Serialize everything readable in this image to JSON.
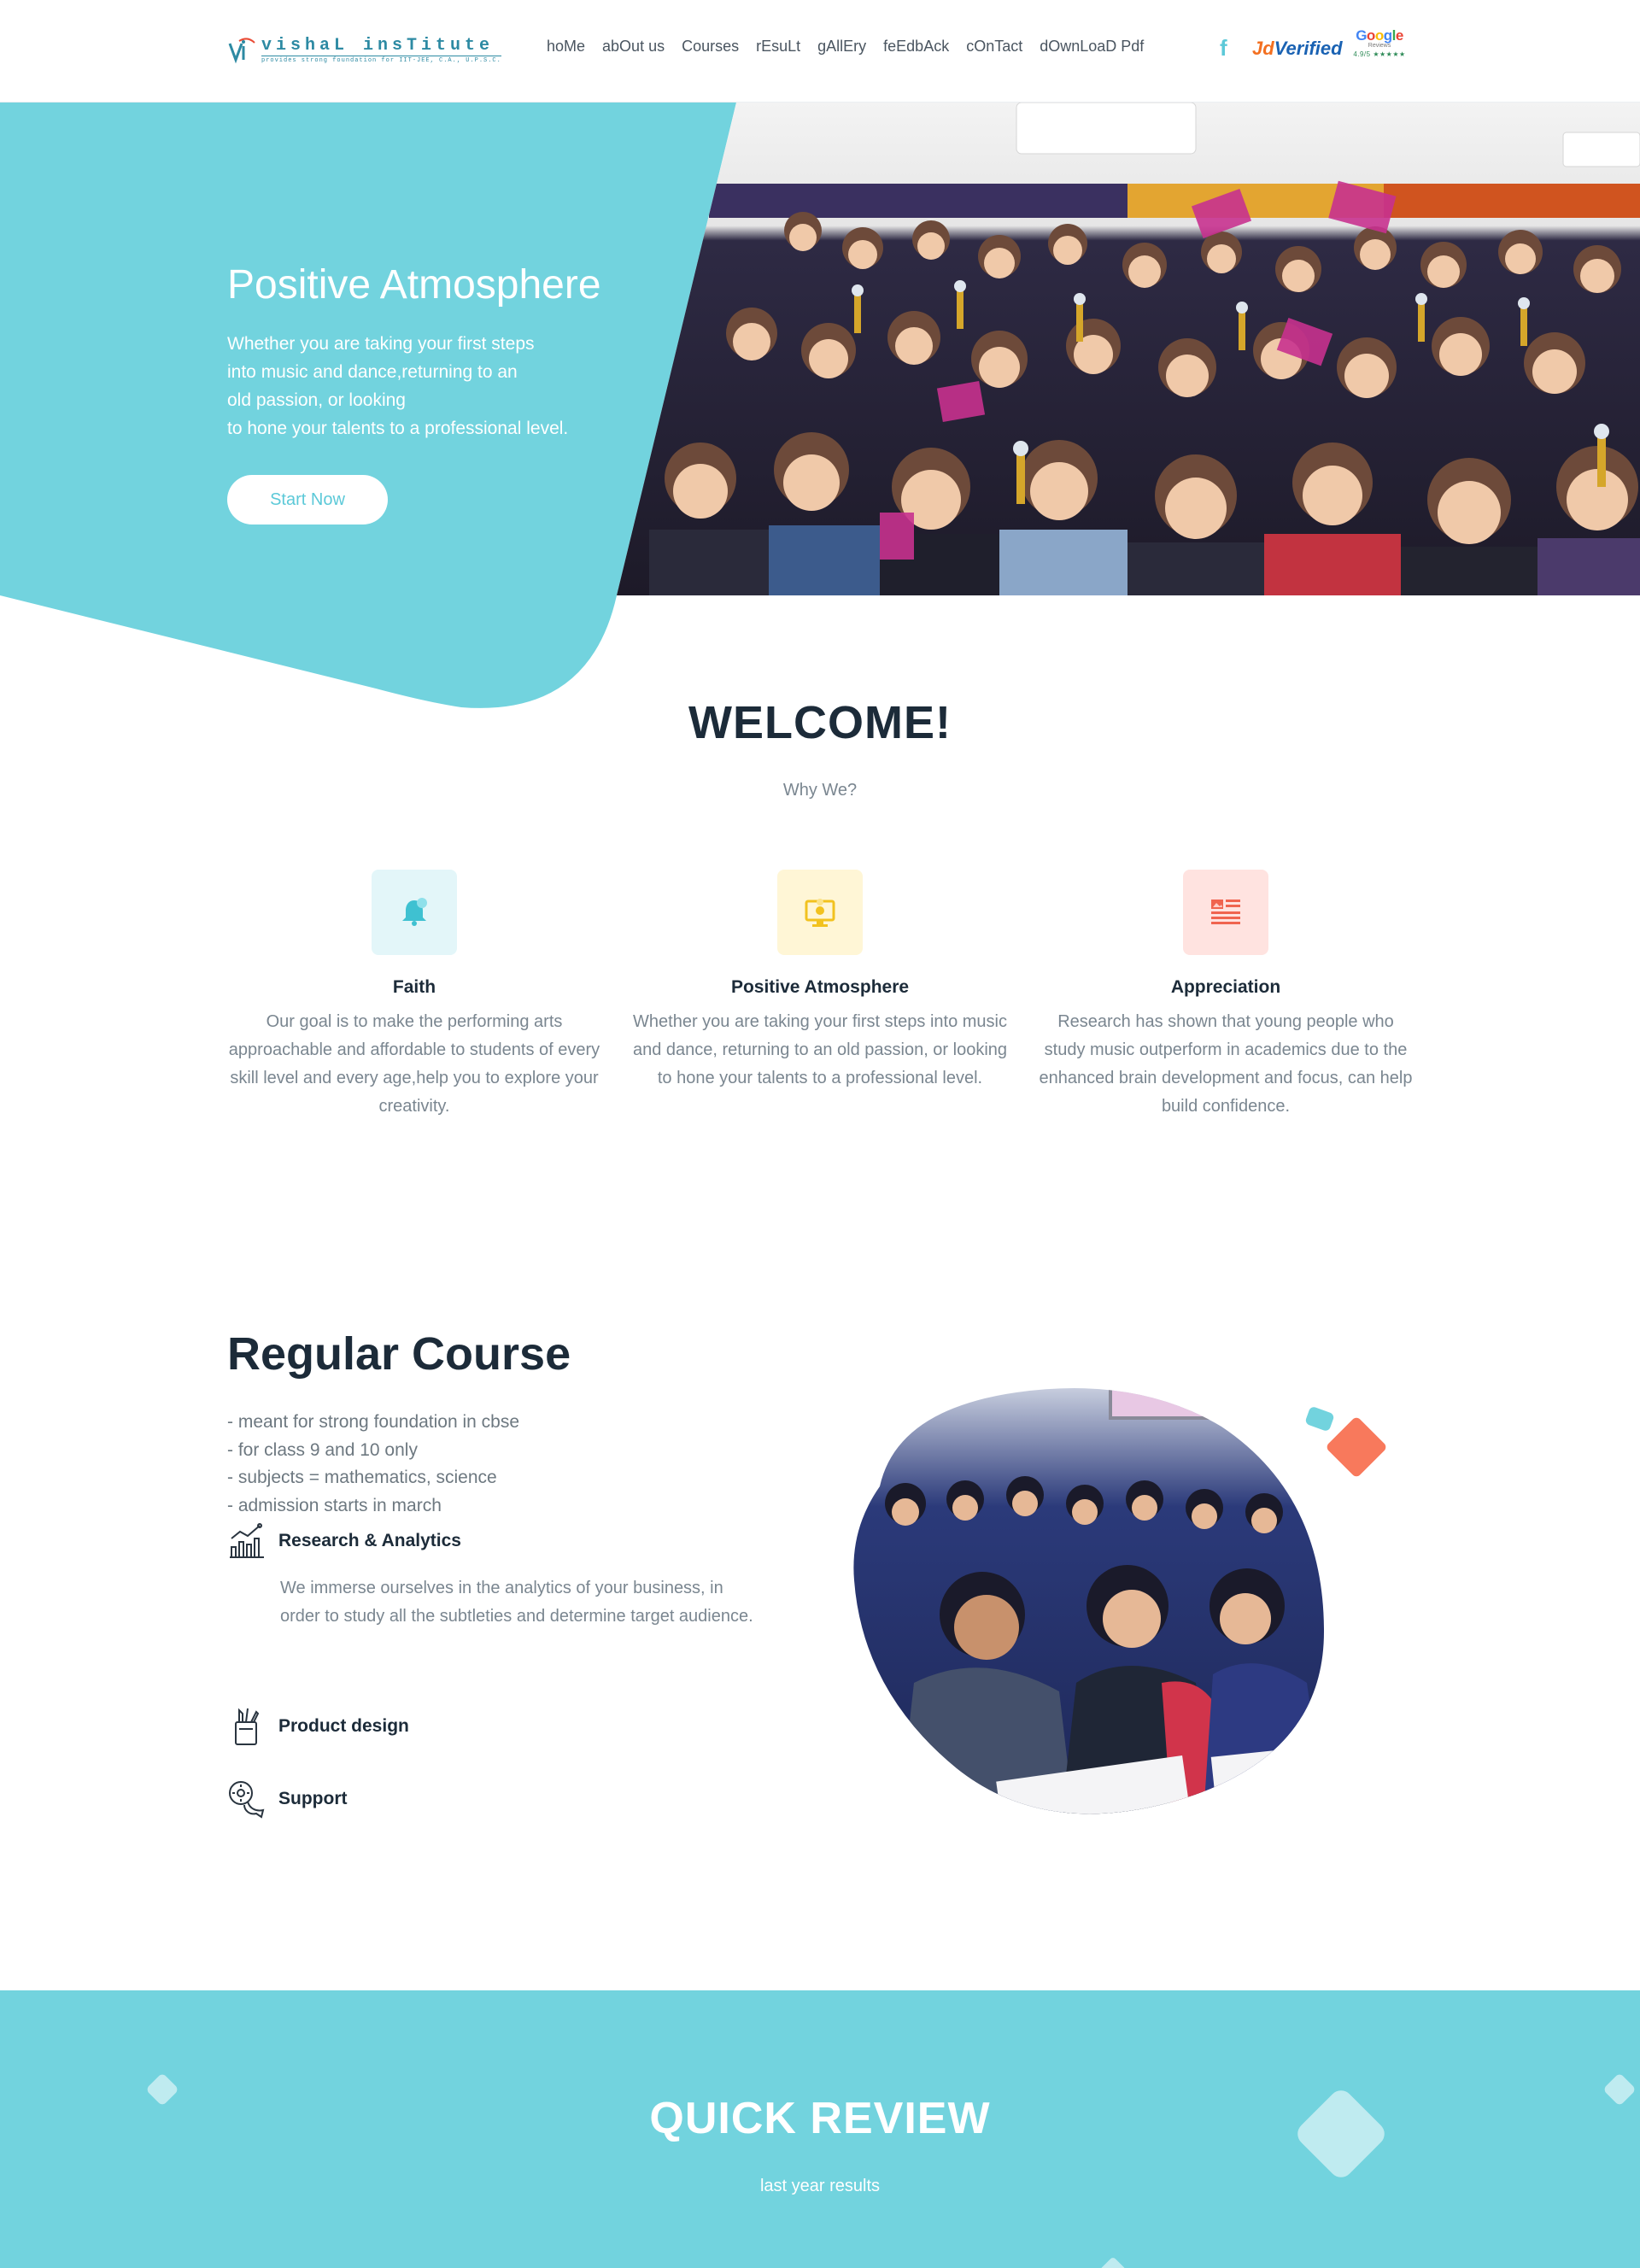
{
  "header": {
    "logo": {
      "title": "vishaL insTitute",
      "tagline": "provides strong foundation for IIT-JEE, C.A., U.P.S.C."
    },
    "nav": [
      {
        "label": "hoMe",
        "name": "nav-home"
      },
      {
        "label": "abOut us",
        "name": "nav-about-us"
      },
      {
        "label": "Courses",
        "name": "nav-courses"
      },
      {
        "label": "rEsuLt",
        "name": "nav-result"
      },
      {
        "label": "gAllEry",
        "name": "nav-gallery"
      },
      {
        "label": "feEdbAck",
        "name": "nav-feedback"
      },
      {
        "label": "cOnTact",
        "name": "nav-contact"
      },
      {
        "label": "dOwnLoaD Pdf",
        "name": "nav-download-pdf"
      }
    ],
    "social": {
      "facebook": "f",
      "jd_prefix": "Jd",
      "jd_suffix": "Verified",
      "google": "Google",
      "google_sub": "Reviews",
      "google_rating": "4.9/5 ★★★★★"
    }
  },
  "hero": {
    "title": "Positive Atmosphere",
    "lines": [
      "Whether you are taking your first steps",
      "into music and dance,returning to an",
      "old passion, or looking",
      "to hone your talents to a professional level."
    ],
    "button": "Start Now",
    "accent_color": "#72d3de"
  },
  "welcome": {
    "title": "WELCOME!",
    "subtitle": "Why We?",
    "features": [
      {
        "icon": "bell-icon",
        "title": "Faith",
        "text": "Our goal is to make the performing arts approachable and affordable to students of every skill level and every age,help you to explore your creativity."
      },
      {
        "icon": "monitor-icon",
        "title": "Positive Atmosphere",
        "text": "Whether you are taking your first steps into music and dance, returning to an old passion, or looking to hone your talents to a professional level."
      },
      {
        "icon": "newspaper-icon",
        "title": "Appreciation",
        "text": "Research has shown that young people who study music outperform in academics due to the enhanced brain development and focus, can help build confidence."
      }
    ]
  },
  "course": {
    "title": "Regular Course",
    "points": [
      "- meant for strong foundation in cbse",
      "- for class 9 and 10 only",
      "- subjects = mathematics, science",
      "- admission starts in march"
    ],
    "services": [
      {
        "icon": "chart-icon",
        "label": "Research & Analytics",
        "desc": "We immerse ourselves in the analytics of your business, in order to study all the subtleties and determine target audience."
      },
      {
        "icon": "pencil-cup-icon",
        "label": "Product design"
      },
      {
        "icon": "chat-gear-icon",
        "label": "Support"
      }
    ]
  },
  "review": {
    "title": "QUICK REVIEW",
    "subtitle": "last year results"
  }
}
